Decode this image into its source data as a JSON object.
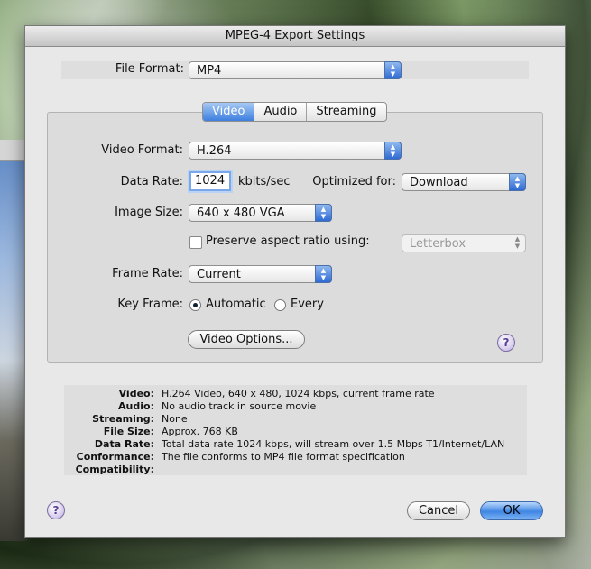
{
  "window": {
    "title": "MPEG-4 Export Settings"
  },
  "file_format": {
    "label": "File Format:",
    "value": "MP4"
  },
  "tabs": [
    {
      "label": "Video",
      "selected": true
    },
    {
      "label": "Audio",
      "selected": false
    },
    {
      "label": "Streaming",
      "selected": false
    }
  ],
  "video": {
    "format_label": "Video Format:",
    "format_value": "H.264",
    "data_rate_label": "Data Rate:",
    "data_rate_value": "1024",
    "data_rate_unit": "kbits/sec",
    "optimized_label": "Optimized for:",
    "optimized_value": "Download",
    "image_size_label": "Image Size:",
    "image_size_value": "640 x 480 VGA",
    "preserve_label": "Preserve aspect ratio using:",
    "preserve_checked": false,
    "preserve_value": "Letterbox",
    "frame_rate_label": "Frame Rate:",
    "frame_rate_value": "Current",
    "key_frame_label": "Key Frame:",
    "key_frame_auto": "Automatic",
    "key_frame_every": "Every",
    "options_button": "Video Options..."
  },
  "summary": [
    {
      "key": "Video:",
      "value": "H.264 Video, 640 x 480, 1024 kbps, current frame rate"
    },
    {
      "key": "Audio:",
      "value": "No audio track in source movie"
    },
    {
      "key": "Streaming:",
      "value": "None"
    },
    {
      "key": "File Size:",
      "value": "Approx. 768 KB"
    },
    {
      "key": "Data Rate:",
      "value": "Total data rate 1024 kbps, will stream over 1.5 Mbps T1/Internet/LAN"
    },
    {
      "key": "Conformance:",
      "value": "The file conforms to MP4 file format specification"
    },
    {
      "key": "Compatibility:",
      "value": ""
    }
  ],
  "buttons": {
    "cancel": "Cancel",
    "ok": "OK",
    "help": "?"
  },
  "icons": {
    "help": "question-mark-icon",
    "popup": "up-down-arrows-icon"
  },
  "colors": {
    "accent": "#3f86e4",
    "help_purple": "#5a3e96"
  }
}
